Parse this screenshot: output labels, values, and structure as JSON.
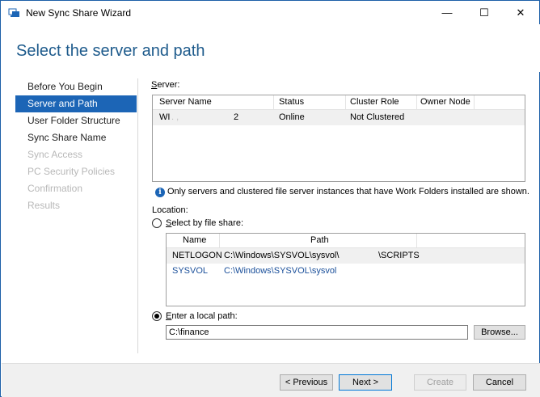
{
  "window": {
    "title": "New Sync Share Wizard",
    "min_glyph": "—",
    "max_glyph": "☐",
    "close_glyph": "✕"
  },
  "header": {
    "page_title": "Select the server and path"
  },
  "nav": {
    "items": [
      {
        "label": "Before You Begin",
        "state": "normal"
      },
      {
        "label": "Server and Path",
        "state": "active"
      },
      {
        "label": "User Folder Structure",
        "state": "normal"
      },
      {
        "label": "Sync Share Name",
        "state": "normal"
      },
      {
        "label": "Sync Access",
        "state": "disabled"
      },
      {
        "label": "PC Security Policies",
        "state": "disabled"
      },
      {
        "label": "Confirmation",
        "state": "disabled"
      },
      {
        "label": "Results",
        "state": "disabled"
      }
    ]
  },
  "server": {
    "label_first": "S",
    "label_rest": "erver:",
    "columns": [
      "Server Name",
      "Status",
      "Cluster Role",
      "Owner Node"
    ],
    "rows": [
      {
        "name_start": "WI",
        "name_end": "2",
        "status": "Online",
        "cluster_role": "Not Clustered",
        "owner_node": ""
      }
    ]
  },
  "info_text": "Only servers and clustered file server instances that have Work Folders installed are shown.",
  "location": {
    "label": "Location:",
    "share_radio_pre": "S",
    "share_radio_rest": "elect by file share:",
    "share_columns": [
      "Name",
      "Path"
    ],
    "shares": [
      {
        "name": "NETLOGON",
        "path_start": "C:\\Windows\\SYSVOL\\sysvol\\",
        "path_end": "\\SCRIPTS"
      },
      {
        "name": "SYSVOL",
        "path_start": "C:\\Windows\\SYSVOL\\sysvol",
        "path_end": ""
      }
    ],
    "local_radio_pre": "E",
    "local_radio_rest": "nter a local path:",
    "local_path_value": "C:\\finance",
    "browse_label": "Browse..."
  },
  "footer": {
    "previous": "< Previous",
    "next": "Next >",
    "create": "Create",
    "cancel": "Cancel"
  },
  "colors": {
    "accent": "#1c65b6",
    "title_blue": "#1e5b8c",
    "link_blue": "#1a4f9a"
  }
}
